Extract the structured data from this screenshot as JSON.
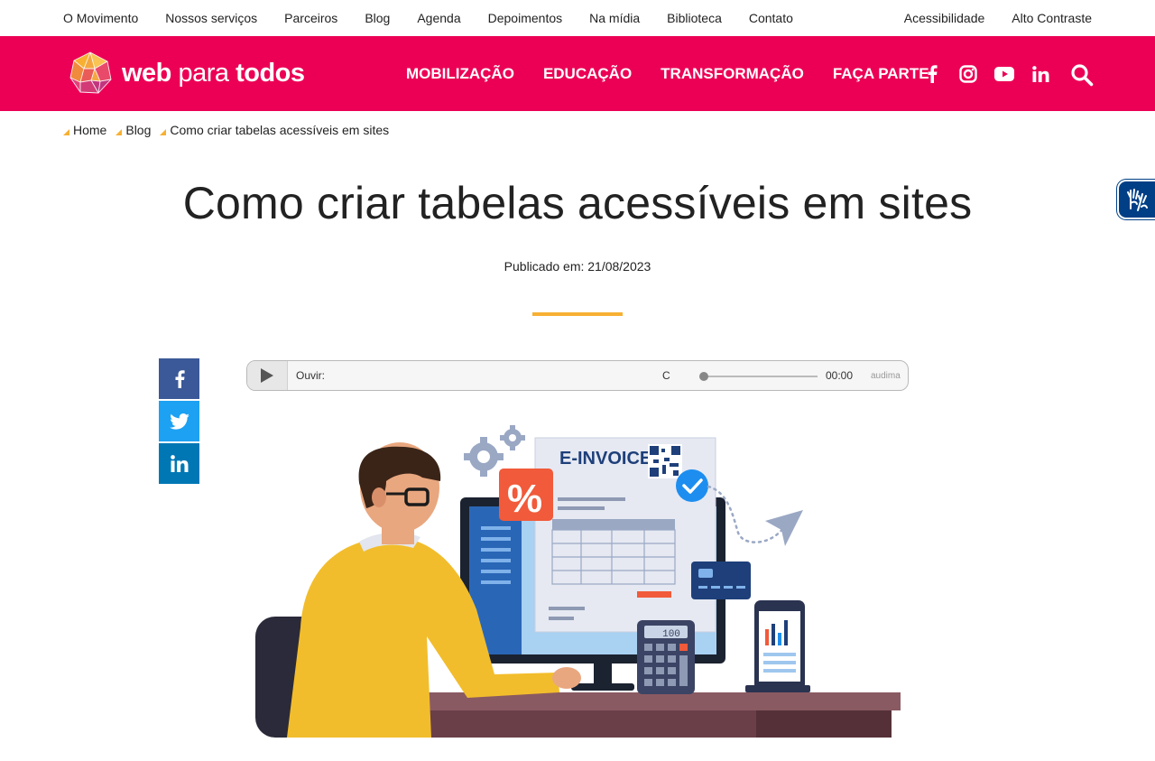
{
  "topbar": {
    "left_links": [
      "O Movimento",
      "Nossos serviços",
      "Parceiros",
      "Blog",
      "Agenda",
      "Depoimentos",
      "Na mídia",
      "Biblioteca",
      "Contato"
    ],
    "right_links": [
      "Acessibilidade",
      "Alto Contraste"
    ]
  },
  "header": {
    "logo": {
      "part1": "web",
      "part2": " para ",
      "part3": "todos"
    },
    "nav": [
      "MOBILIZAÇÃO",
      "EDUCAÇÃO",
      "TRANSFORMAÇÃO",
      "FAÇA PARTE"
    ],
    "social_icons": [
      "facebook-icon",
      "instagram-icon",
      "youtube-icon",
      "linkedin-icon"
    ],
    "search_icon": "search-icon",
    "accent_color": "#ec0055"
  },
  "breadcrumb": [
    "Home",
    "Blog",
    "Como criar tabelas acessíveis em sites"
  ],
  "article": {
    "title": "Como criar tabelas acessíveis em sites",
    "published": "Publicado em: 21/08/2023",
    "divider_color": "#f7b032"
  },
  "share": {
    "buttons": [
      {
        "name": "facebook-share",
        "color": "#3b5998"
      },
      {
        "name": "twitter-share",
        "color": "#1da1f2"
      },
      {
        "name": "linkedin-share",
        "color": "#0077b5"
      }
    ]
  },
  "player": {
    "label": "Ouvir:",
    "c_label": "C",
    "time": "00:00",
    "brand": "audima",
    "progress": 0
  },
  "illustration": {
    "invoice_title": "E-INVOICE",
    "percent": "%",
    "calc_display": "100"
  }
}
